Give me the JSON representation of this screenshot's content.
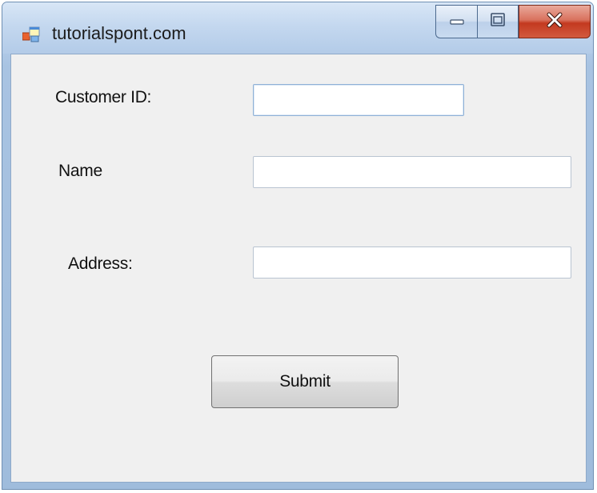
{
  "window": {
    "title": "tutorialspont.com",
    "icon": "winforms-app-icon",
    "caption_buttons": {
      "minimize_icon": "minimize-icon",
      "maximize_icon": "maximize-icon",
      "close_icon": "close-icon"
    }
  },
  "form": {
    "customer_id": {
      "label": "Customer ID:",
      "value": ""
    },
    "name": {
      "label": "Name",
      "value": ""
    },
    "address": {
      "label": "Address:",
      "value": ""
    },
    "submit_label": "Submit"
  },
  "colors": {
    "client_background": "#f0f0f0",
    "close_button": "#c3391f",
    "title_bar": "#c4d8ef"
  }
}
